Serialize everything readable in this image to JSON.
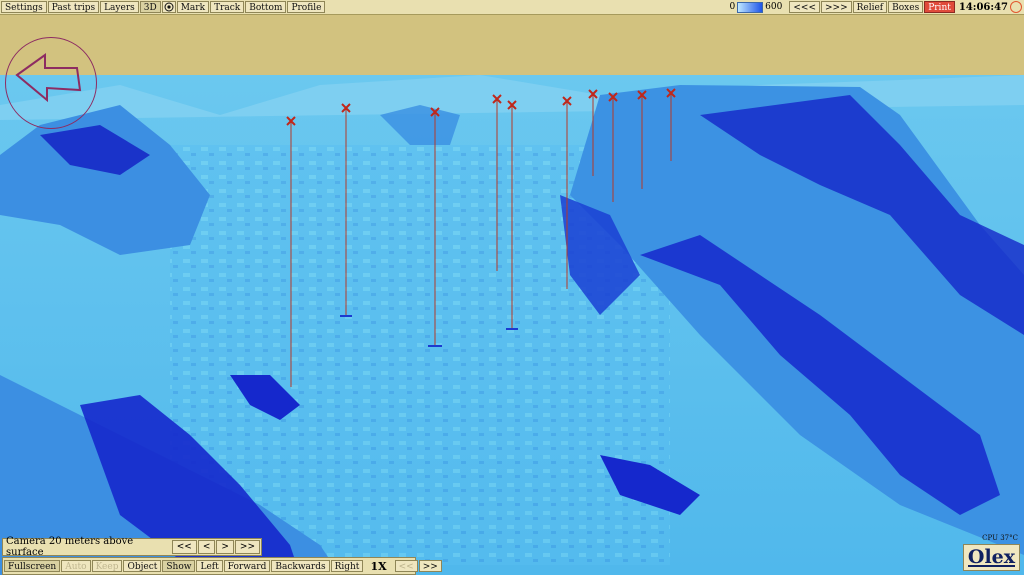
{
  "topbar": {
    "left_buttons": [
      "Settings",
      "Past trips",
      "Layers",
      "3D",
      "Mark",
      "Track",
      "Bottom",
      "Profile"
    ],
    "legend_min": "0",
    "legend_max": "600",
    "right_buttons": [
      "<<<",
      ">>>",
      "Relief",
      "Boxes",
      "Print"
    ],
    "time": "14:06:47"
  },
  "camera": {
    "status": "Camera 20 meters above surface",
    "buttons": [
      "<<",
      "<",
      ">",
      ">>"
    ]
  },
  "bottombar": {
    "buttons": [
      "Fullscreen",
      "Auto",
      "Keep",
      "Object",
      "Show",
      "Left",
      "Forward",
      "Backwards",
      "Right"
    ],
    "speed": "1X",
    "speed_buttons": [
      "<<",
      ">>"
    ]
  },
  "cpu": "CPU 37°C",
  "logo": "Olex",
  "colors": {
    "terrain_dark": "#0f22c9",
    "terrain_mid": "#2f7fe3",
    "terrain_light": "#6ad0f1",
    "marker_line": "#b33a2a",
    "sky": "#d2c27f"
  },
  "markers": [
    {
      "id": 1
    },
    {
      "id": 2
    },
    {
      "id": 3
    },
    {
      "id": 4
    },
    {
      "id": 5
    },
    {
      "id": 6
    },
    {
      "id": 7
    },
    {
      "id": 8
    },
    {
      "id": 9
    },
    {
      "id": 10
    }
  ]
}
